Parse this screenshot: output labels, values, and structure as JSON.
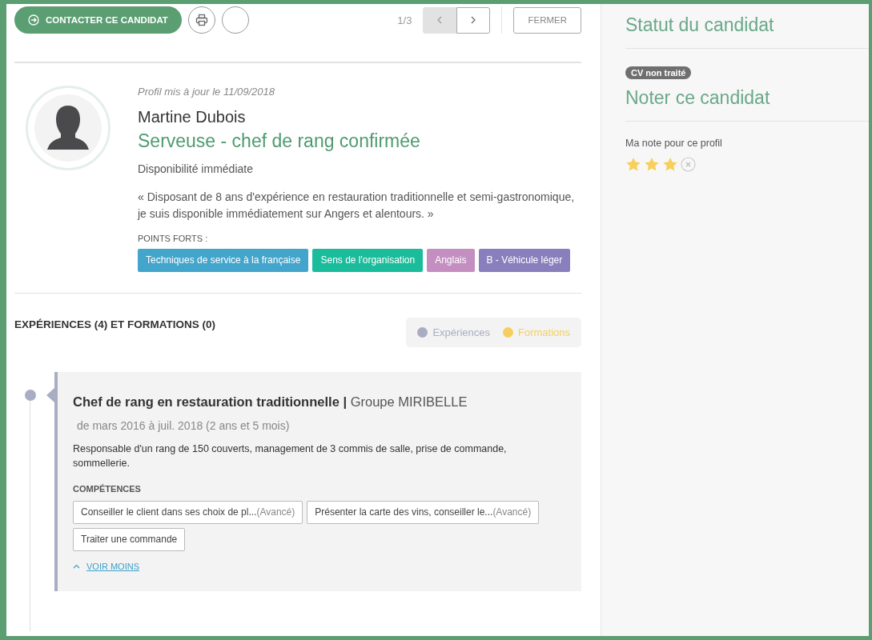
{
  "toolbar": {
    "contact_button": "CONTACTER CE CANDIDAT",
    "pager": "1/3",
    "prev_disabled": true,
    "next_disabled": false,
    "close_button": "FERMER"
  },
  "profile": {
    "updated": "Profil mis à jour le 11/09/2018",
    "name": "Martine Dubois",
    "title": "Serveuse - chef de rang confirmée",
    "availability": "Disponibilité immédiate",
    "summary": "« Disposant de 8 ans d'expérience en restauration traditionnelle et semi-gastronomique, je suis disponible immédiatement sur Angers et alentours. »",
    "strengths_label": "POINTS FORTS :",
    "strengths": [
      {
        "label": "Techniques de service à la française",
        "color": "#43a5cb"
      },
      {
        "label": "Sens de l'organisation",
        "color": "#1abc9c"
      },
      {
        "label": "Anglais",
        "color": "#c48fc0"
      },
      {
        "label": "B - Véhicule léger",
        "color": "#8a7fbd"
      }
    ]
  },
  "experiences": {
    "heading": "EXPÉRIENCES (4) ET FORMATIONS (0)",
    "legend": [
      {
        "label": "Expériences",
        "color": "#a9adc4"
      },
      {
        "label": "Formations",
        "color": "#f5cf5e"
      }
    ],
    "items": [
      {
        "title": "Chef de rang en restauration traditionnelle",
        "separator": "|",
        "company": "Groupe MIRIBELLE",
        "period": "de mars 2016 à juil. 2018 (2 ans et 5 mois)",
        "description": "Responsable d'un rang de 150 couverts, management de 3 commis de salle, prise de commande, sommellerie.",
        "skills_label": "COMPÉTENCES",
        "skills": [
          {
            "label": "Conseiller le client dans ses choix de pl...",
            "level": "(Avancé)"
          },
          {
            "label": "Présenter la carte des vins, conseiller le...",
            "level": "(Avancé)"
          },
          {
            "label": "Traiter une commande"
          }
        ],
        "toggle": "VOIR MOINS",
        "expanded": true
      }
    ]
  },
  "sidebar": {
    "status_title": "Statut du candidat",
    "status_badge": "CV non traité",
    "rating_title": "Noter ce candidat",
    "rating_label": "Ma note pour ce profil",
    "stars": 3
  }
}
